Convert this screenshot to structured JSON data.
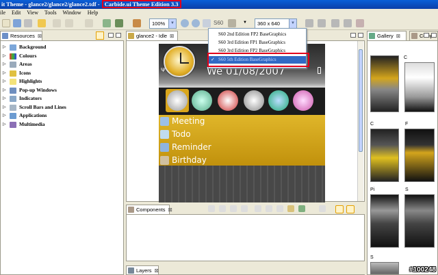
{
  "window": {
    "title_prefix": "it Theme - glance2/glance2/glance2.tdf - ",
    "title_highlight": "Carbide.ui Theme Edition 3.3"
  },
  "menu": [
    "ile",
    "Edit",
    "View",
    "Tools",
    "Window",
    "Help"
  ],
  "toolbar": {
    "zoom": "100%",
    "platform_label": "S60",
    "resolution": "360 x 640"
  },
  "resources": {
    "tab_label": "Resources",
    "items": [
      "Background",
      "Colours",
      "Areas",
      "Icons",
      "Highlights",
      "Pop-up Windows",
      "Indicators",
      "Scroll Bars and Lines",
      "Applications",
      "Multimedia"
    ]
  },
  "editor": {
    "tab_label": "glance2 - Idle",
    "date": "We 01/08/2007",
    "menu_items": [
      "Meeting",
      "Todo",
      "Reminder",
      "Birthday"
    ]
  },
  "platform_dropdown": {
    "options": [
      "S60 2nd Edition FP2 BaseGraphics",
      "S60 3rd Edition FP1 BaseGraphics",
      "S60 3rd Edition FP2 BaseGraphics",
      "S60 5th Edition BaseGraphics"
    ],
    "selected_index": 3,
    "check": "✓"
  },
  "components": {
    "tab_label": "Components"
  },
  "layers": {
    "tab_label": "Layers"
  },
  "gallery": {
    "tab_label": "Gallery",
    "tab2_label": "Compo",
    "thumb_labels": [
      "C",
      "C",
      "F",
      "Pi",
      "S",
      "S"
    ]
  },
  "watermark": "#100248",
  "colors": {
    "accent_red": "#e4001b",
    "title_blue": "#0b3fa8",
    "menu_gold": "#d4a51c"
  }
}
